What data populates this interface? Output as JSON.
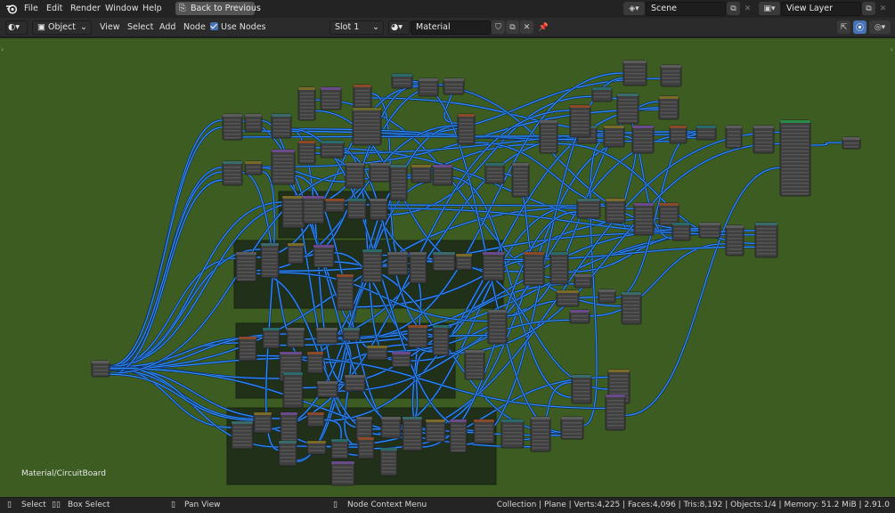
{
  "topbar": {
    "menus": [
      "File",
      "Edit",
      "Render",
      "Window",
      "Help"
    ],
    "back_button": "Back to Previous",
    "scene": "Scene",
    "view_layer": "View Layer"
  },
  "header": {
    "mode": "Object",
    "menus": [
      "View",
      "Select",
      "Add",
      "Node"
    ],
    "use_nodes_label": "Use Nodes",
    "use_nodes_checked": true,
    "slot": "Slot 1",
    "material": "Material"
  },
  "editor": {
    "material_path": "Material/CircuitBoard",
    "background_color": "#3c5c22",
    "link_color": "#2f8cff"
  },
  "statusbar": {
    "select": "Select",
    "box_select": "Box Select",
    "pan_view": "Pan View",
    "context_menu": "Node Context Menu",
    "info": "Collection | Plane | Verts:4,225 | Faces:4,096 | Tris:8,192 | Objects:1/4 | Memory: 51.2 MiB | 2.91.0"
  }
}
